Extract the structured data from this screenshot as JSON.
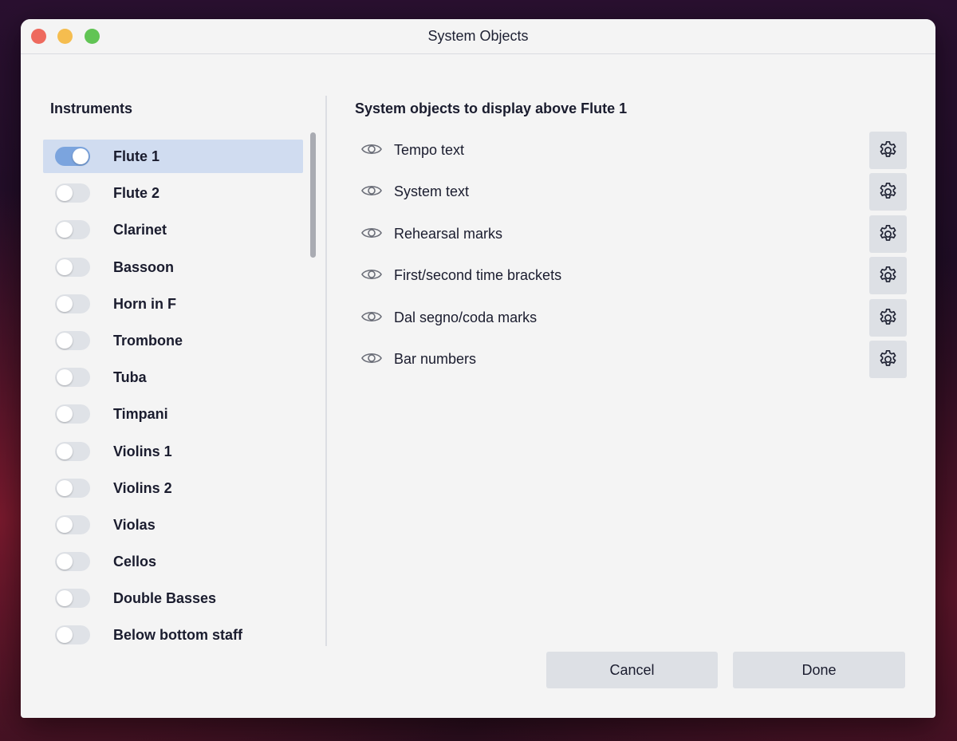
{
  "window": {
    "title": "System Objects"
  },
  "left": {
    "heading": "Instruments",
    "items": [
      {
        "label": "Flute 1",
        "on": true,
        "selected": true
      },
      {
        "label": "Flute 2",
        "on": false,
        "selected": false
      },
      {
        "label": "Clarinet",
        "on": false,
        "selected": false
      },
      {
        "label": "Bassoon",
        "on": false,
        "selected": false
      },
      {
        "label": "Horn in F",
        "on": false,
        "selected": false
      },
      {
        "label": "Trombone",
        "on": false,
        "selected": false
      },
      {
        "label": "Tuba",
        "on": false,
        "selected": false
      },
      {
        "label": "Timpani",
        "on": false,
        "selected": false
      },
      {
        "label": "Violins 1",
        "on": false,
        "selected": false
      },
      {
        "label": "Violins 2",
        "on": false,
        "selected": false
      },
      {
        "label": "Violas",
        "on": false,
        "selected": false
      },
      {
        "label": "Cellos",
        "on": false,
        "selected": false
      },
      {
        "label": "Double Basses",
        "on": false,
        "selected": false
      },
      {
        "label": "Below bottom staff",
        "on": false,
        "selected": false
      }
    ]
  },
  "right": {
    "heading": "System objects to display above Flute 1",
    "objects": [
      {
        "label": "Tempo text",
        "icon": "eye-icon",
        "settings_icon": "gear-icon"
      },
      {
        "label": "System text",
        "icon": "eye-icon",
        "settings_icon": "gear-icon"
      },
      {
        "label": "Rehearsal marks",
        "icon": "eye-icon",
        "settings_icon": "gear-icon"
      },
      {
        "label": "First/second time brackets",
        "icon": "eye-icon",
        "settings_icon": "gear-icon"
      },
      {
        "label": "Dal segno/coda marks",
        "icon": "eye-icon",
        "settings_icon": "gear-icon"
      },
      {
        "label": "Bar numbers",
        "icon": "eye-icon",
        "settings_icon": "gear-icon"
      }
    ]
  },
  "footer": {
    "cancel_label": "Cancel",
    "done_label": "Done"
  },
  "colors": {
    "toggle_on": "#7ba4de",
    "toggle_off": "#dfe2e7",
    "selected_row": "#d0dcf0",
    "button_bg": "#dde0e5"
  }
}
